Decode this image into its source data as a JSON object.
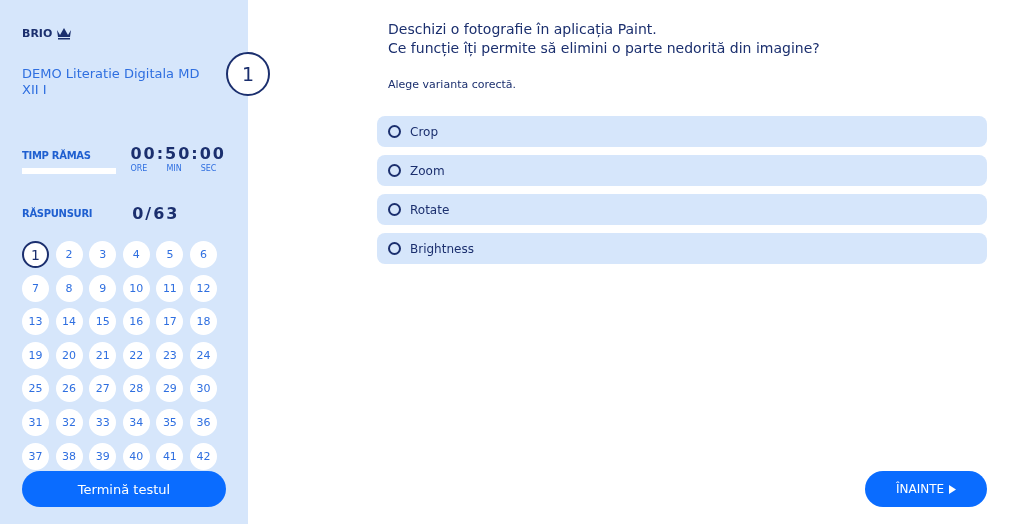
{
  "sidebar": {
    "logo": "BRIO",
    "test_title": "DEMO Literatie Digitala MD XII I",
    "question_badge": "1",
    "timer": {
      "label": "TIMP RĂMAS",
      "level": 1,
      "value": "00:50:00",
      "units": [
        "ORE",
        "MIN",
        "SEC"
      ]
    },
    "answers": {
      "label": "RĂSPUNSURI",
      "value": "0/63"
    },
    "questions": [
      {
        "label": "1",
        "selected": true
      },
      {
        "label": "2",
        "selected": false
      },
      {
        "label": "3",
        "selected": false
      },
      {
        "label": "4",
        "selected": false
      },
      {
        "label": "5",
        "selected": false
      },
      {
        "label": "6",
        "selected": false
      },
      {
        "label": "7",
        "selected": false
      },
      {
        "label": "8",
        "selected": false
      },
      {
        "label": "9",
        "selected": false
      },
      {
        "label": "10",
        "selected": false
      },
      {
        "label": "11",
        "selected": false
      },
      {
        "label": "12",
        "selected": false
      },
      {
        "label": "13",
        "selected": false
      },
      {
        "label": "14",
        "selected": false
      },
      {
        "label": "15",
        "selected": false
      },
      {
        "label": "16",
        "selected": false
      },
      {
        "label": "17",
        "selected": false
      },
      {
        "label": "18",
        "selected": false
      },
      {
        "label": "19",
        "selected": false
      },
      {
        "label": "20",
        "selected": false
      },
      {
        "label": "21",
        "selected": false
      },
      {
        "label": "22",
        "selected": false
      },
      {
        "label": "23",
        "selected": false
      },
      {
        "label": "24",
        "selected": false
      },
      {
        "label": "25",
        "selected": false
      },
      {
        "label": "26",
        "selected": false
      },
      {
        "label": "27",
        "selected": false
      },
      {
        "label": "28",
        "selected": false
      },
      {
        "label": "29",
        "selected": false
      },
      {
        "label": "30",
        "selected": false
      },
      {
        "label": "31",
        "selected": false
      },
      {
        "label": "32",
        "selected": false
      },
      {
        "label": "33",
        "selected": false
      },
      {
        "label": "34",
        "selected": false
      },
      {
        "label": "35",
        "selected": false
      },
      {
        "label": "36",
        "selected": false
      },
      {
        "label": "37",
        "selected": false
      },
      {
        "label": "38",
        "selected": false
      },
      {
        "label": "39",
        "selected": false
      },
      {
        "label": "40",
        "selected": false
      },
      {
        "label": "41",
        "selected": false
      },
      {
        "label": "42",
        "selected": false
      }
    ],
    "finish_button": "Termină testul"
  },
  "question": {
    "lines": [
      "Deschizi o fotografie în aplicația Paint.",
      "Ce funcție îți permite să elimini o parte nedorită din imagine?"
    ],
    "instruction": "Alege varianta corectă.",
    "options": [
      {
        "label": "Crop",
        "selected": false
      },
      {
        "label": "Zoom",
        "selected": false
      },
      {
        "label": "Rotate",
        "selected": false
      },
      {
        "label": "Brightness",
        "selected": false
      }
    ]
  },
  "next_button": "ÎNAINTE"
}
